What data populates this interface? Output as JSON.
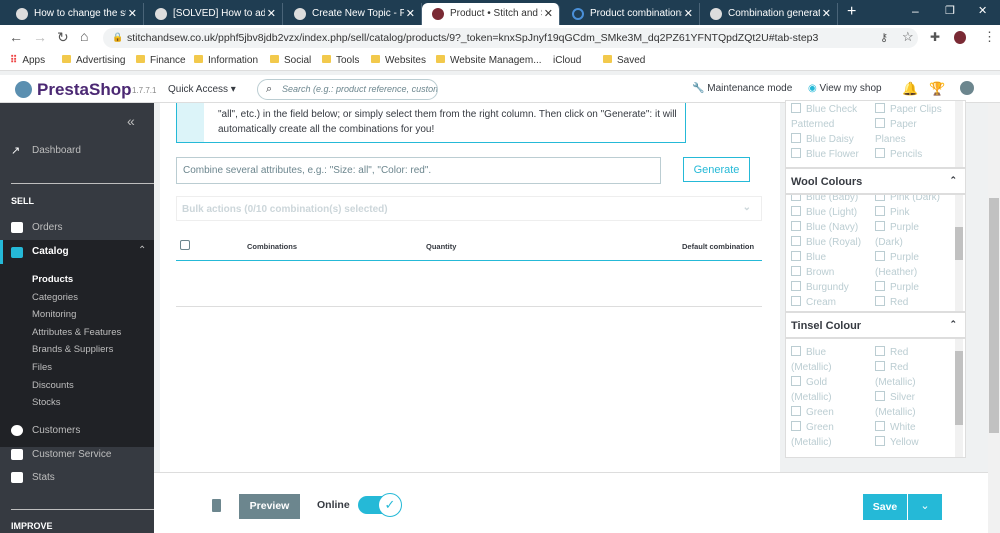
{
  "browser": {
    "tabs": [
      {
        "title": "How to change the style"
      },
      {
        "title": "[SOLVED] How to add n"
      },
      {
        "title": "Create New Topic - Pre"
      },
      {
        "title": "Product • Stitch and Sew"
      },
      {
        "title": "Product combinations"
      },
      {
        "title": "Combination generator"
      }
    ],
    "new_tab": "+",
    "window_controls": {
      "minimize": "–",
      "restore": "❐",
      "close": "✕"
    },
    "url": "stitchandsew.co.uk/pphf5jbv8jdb2vzx/index.php/sell/catalog/products/9?_token=knxSpJnyf19qGCdm_SMke3M_dq2PZ61YFNTQpdZQt2U#tab-step3",
    "bookmarks": [
      "Apps",
      "Advertising",
      "Finance",
      "Information",
      "Social",
      "Tools",
      "Websites",
      "Website Managem...",
      "iCloud",
      "Saved"
    ]
  },
  "header": {
    "brand": "PrestaShop",
    "version": "1.7.7.1",
    "quick_access": "Quick Access",
    "search_placeholder": "Search (e.g.: product reference, custome",
    "maintenance": "Maintenance mode",
    "view_shop": "View my shop"
  },
  "sidebar": {
    "collapse": "«",
    "dashboard": "Dashboard",
    "sell_heading": "SELL",
    "orders": "Orders",
    "catalog": "Catalog",
    "catalog_items": [
      "Products",
      "Categories",
      "Monitoring",
      "Attributes & Features",
      "Brands & Suppliers",
      "Files",
      "Discounts",
      "Stocks"
    ],
    "customers": "Customers",
    "customer_service": "Customer Service",
    "stats": "Stats",
    "improve_heading": "IMPROVE"
  },
  "main": {
    "info_line1": "\"all\", etc.) in the field below; or simply select them from the right column. Then click on \"Generate\": it will",
    "info_line2": "automatically create all the combinations for you!",
    "combine_placeholder": "Combine several attributes, e.g.: \"Size: all\", \"Color: red\".",
    "generate": "Generate",
    "bulk_actions": "Bulk actions (0/10 combination(s) selected)",
    "columns": [
      "Combinations",
      "Quantity",
      "Default combination"
    ]
  },
  "attributes": {
    "top_left": [
      "Blue Check",
      "Patterned",
      "Blue Daisy",
      "Blue Flower"
    ],
    "top_right": [
      "Paper Clips",
      "Paper",
      "Planes",
      "Pencils"
    ],
    "wool": {
      "title": "Wool Colours",
      "left": [
        "Blue (Baby)",
        "Blue (Light)",
        "Blue (Navy)",
        "Blue (Royal)",
        "Blue",
        "Brown",
        "Burgundy",
        "Cream"
      ],
      "right": [
        "Pink (Dark)",
        "Pink",
        "Purple",
        "(Dark)",
        "Purple",
        "(Heather)",
        "Purple",
        "Red"
      ]
    },
    "tinsel": {
      "title": "Tinsel Colour",
      "left": [
        "Blue",
        "(Metallic)",
        "Gold",
        "(Metallic)",
        "Green",
        "Green",
        "(Metallic)"
      ],
      "right": [
        "Red",
        "Red",
        "(Metallic)",
        "Silver",
        "(Metallic)",
        "White",
        "Yellow"
      ]
    }
  },
  "footer": {
    "preview": "Preview",
    "online": "Online",
    "save": "Save"
  },
  "colors": {
    "accent": "#25b9d7",
    "sidebar": "#363a41",
    "tabbar": "#1f3d52"
  }
}
